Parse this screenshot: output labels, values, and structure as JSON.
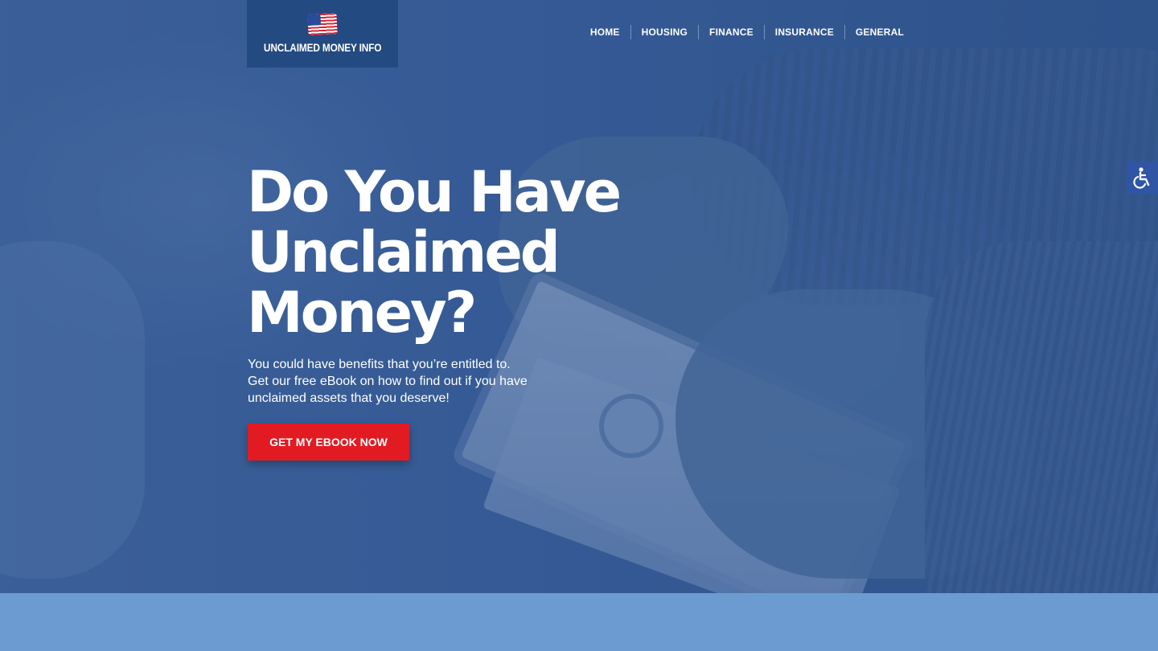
{
  "site": {
    "logo_text": "UNCLAIMED MONEY INFO",
    "logo_icon": "us-flag-icon"
  },
  "nav": {
    "items": [
      {
        "label": "HOME"
      },
      {
        "label": "HOUSING"
      },
      {
        "label": "FINANCE"
      },
      {
        "label": "INSURANCE"
      },
      {
        "label": "GENERAL"
      }
    ]
  },
  "hero": {
    "headline_line1": "Do You Have",
    "headline_line2": "Unclaimed",
    "headline_line3": "Money?",
    "subtext": "You could have benefits that you’re entitled to. Get our free eBook on how to find out if you have unclaimed assets that you deserve!",
    "cta_label": "GET MY EBOOK NOW"
  },
  "accessibility": {
    "icon": "wheelchair-icon"
  },
  "colors": {
    "logo_bg": "#244a82",
    "cta": "#e21b23",
    "band": "#6b9bd1",
    "a11y_button": "#2f55a4"
  }
}
